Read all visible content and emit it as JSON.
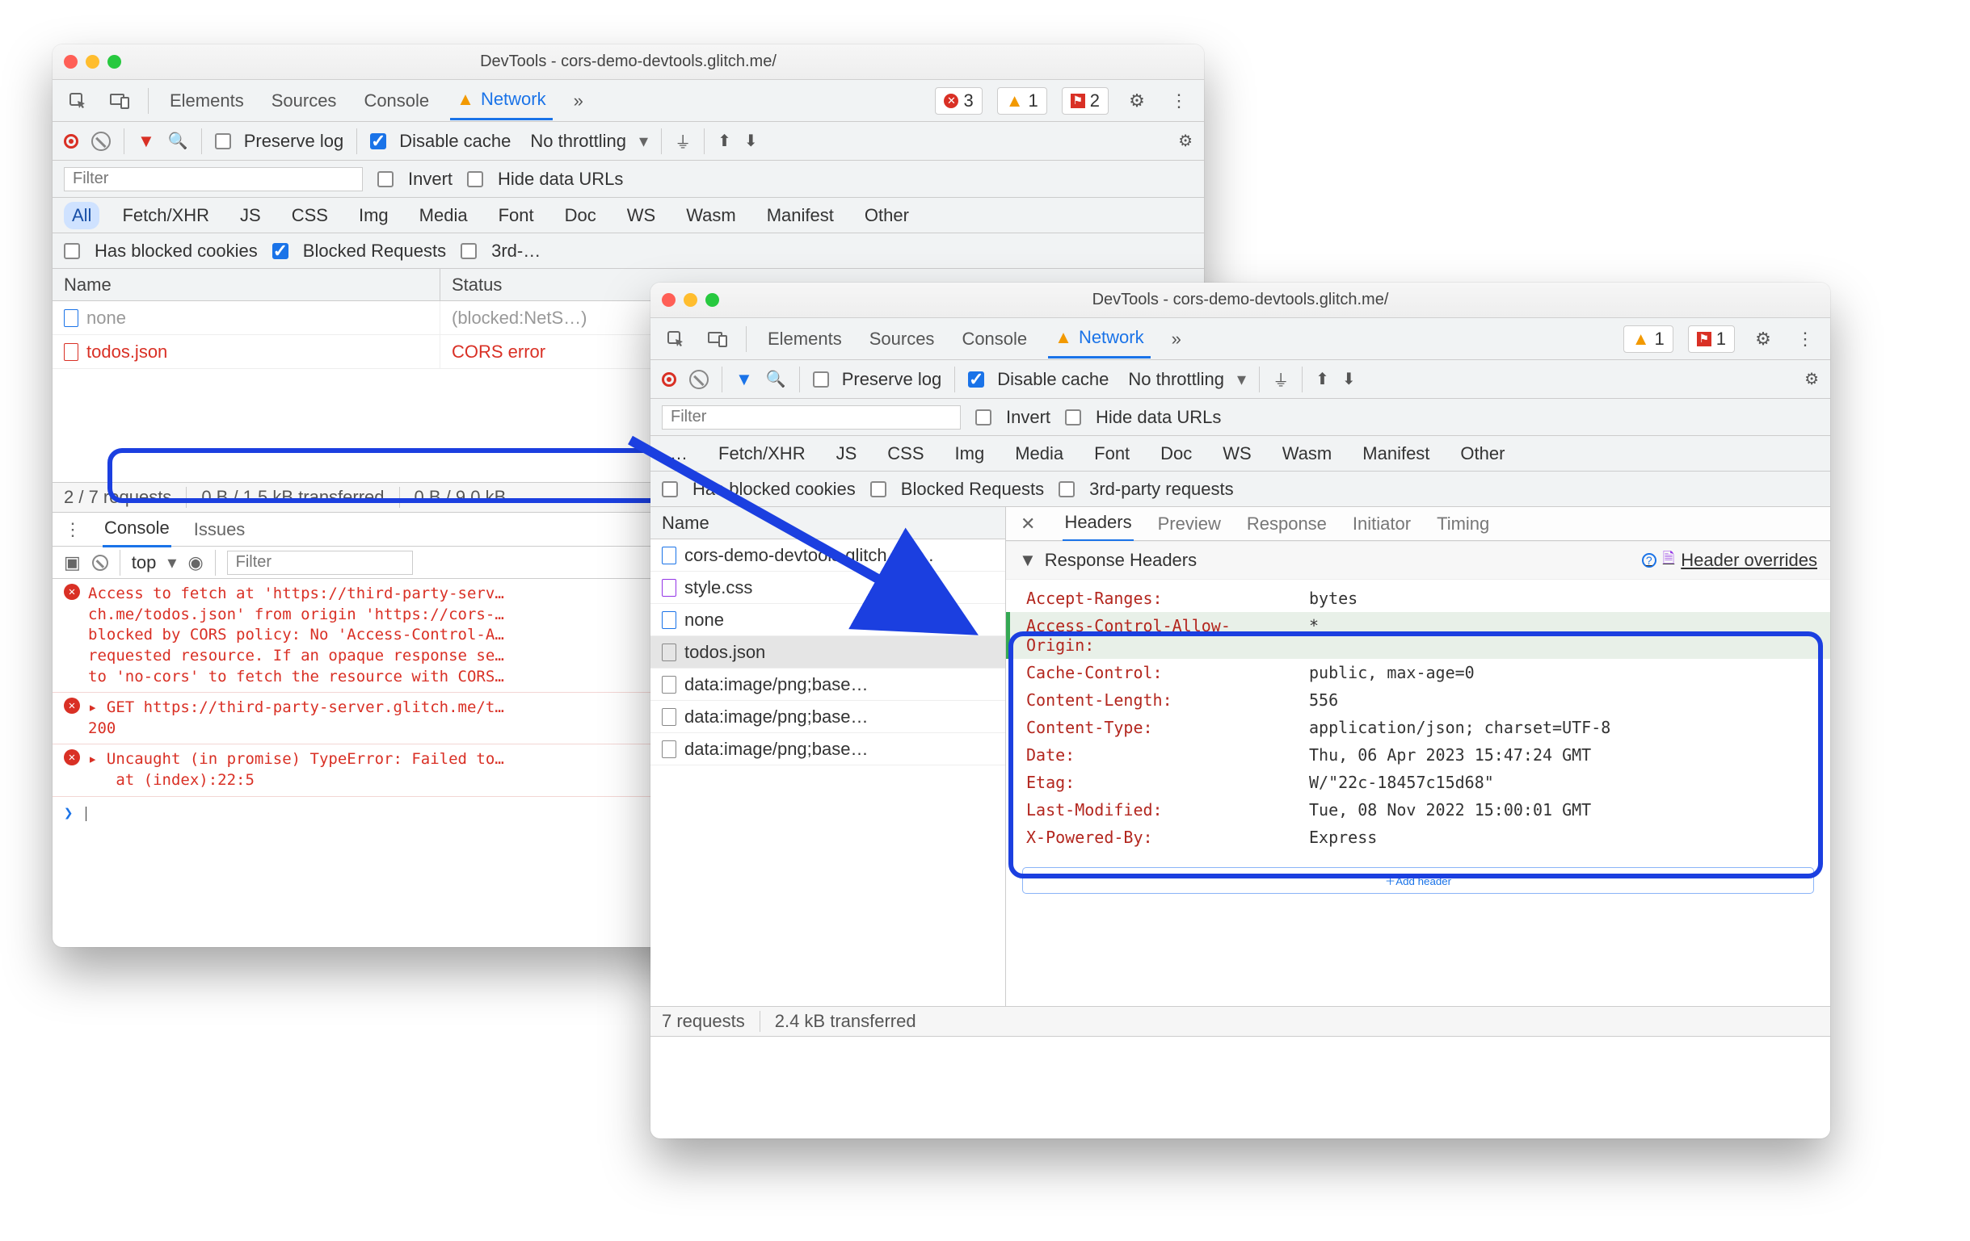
{
  "win1": {
    "title": "DevTools - cors-demo-devtools.glitch.me/",
    "tabs": [
      "Elements",
      "Sources",
      "Console",
      "Network"
    ],
    "active_tab": "Network",
    "badges": {
      "err": "3",
      "warn": "1",
      "issue": "2"
    },
    "netbar": {
      "preserve": "Preserve log",
      "disable_cache": "Disable cache",
      "throttling": "No throttling"
    },
    "filter_placeholder": "Filter",
    "invert": "Invert",
    "hide_data_urls": "Hide data URLs",
    "types": [
      "All",
      "Fetch/XHR",
      "JS",
      "CSS",
      "Img",
      "Media",
      "Font",
      "Doc",
      "WS",
      "Wasm",
      "Manifest",
      "Other"
    ],
    "blocked_cookies": "Has blocked cookies",
    "blocked_requests": "Blocked Requests",
    "third_party": "3rd-…",
    "columns": {
      "name": "Name",
      "status": "Status"
    },
    "rows": [
      {
        "name": "none",
        "status": "(blocked:NetS…)"
      },
      {
        "name": "todos.json",
        "status": "CORS error",
        "error": true
      }
    ],
    "footer": {
      "requests": "2 / 7 requests",
      "transferred": "0 B / 1.5 kB transferred",
      "resources": "0 B / 9.0 kB …"
    },
    "drawer_tabs": [
      "Console",
      "Issues"
    ],
    "console_context": "top",
    "console_filter": "Filter",
    "console_msgs": [
      "Access to fetch at 'https://third-party-serv…\nch.me/todos.json' from origin 'https://cors-…\nblocked by CORS policy: No 'Access-Control-A…\nrequested resource. If an opaque response se…\nto 'no-cors' to fetch the resource with CORS…",
      "▸ GET https://third-party-server.glitch.me/t…\n200",
      "▸ Uncaught (in promise) TypeError: Failed to…\n   at (index):22:5"
    ]
  },
  "win2": {
    "title": "DevTools - cors-demo-devtools.glitch.me/",
    "tabs": [
      "Elements",
      "Sources",
      "Console",
      "Network"
    ],
    "active_tab": "Network",
    "badges": {
      "warn": "1",
      "issue": "1"
    },
    "netbar": {
      "preserve": "Preserve log",
      "disable_cache": "Disable cache",
      "throttling": "No throttling"
    },
    "filter_placeholder": "Filter",
    "invert": "Invert",
    "hide_data_urls": "Hide data URLs",
    "types": [
      "…",
      "Fetch/XHR",
      "JS",
      "CSS",
      "Img",
      "Media",
      "Font",
      "Doc",
      "WS",
      "Wasm",
      "Manifest",
      "Other"
    ],
    "blocked_cookies": "Has blocked cookies",
    "blocked_requests": "Blocked Requests",
    "third_party": "3rd-party requests",
    "left_header": "Name",
    "requests": [
      {
        "name": "cors-demo-devtools.glitch.me…",
        "type": "doc"
      },
      {
        "name": "style.css",
        "type": "css"
      },
      {
        "name": "none",
        "type": "doc"
      },
      {
        "name": "todos.json",
        "type": "gray",
        "selected": true
      },
      {
        "name": "data:image/png;base…",
        "type": "gray"
      },
      {
        "name": "data:image/png;base…",
        "type": "gray"
      },
      {
        "name": "data:image/png;base…",
        "type": "gray"
      }
    ],
    "detail_tabs": [
      "Headers",
      "Preview",
      "Response",
      "Initiator",
      "Timing"
    ],
    "detail_active": "Headers",
    "response_headers_label": "Response Headers",
    "header_overrides_link": "Header overrides",
    "headers": [
      {
        "name": "Accept-Ranges:",
        "value": "bytes"
      },
      {
        "name": "Access-Control-Allow-Origin:",
        "value": "*",
        "edited": true
      },
      {
        "name": "Cache-Control:",
        "value": "public, max-age=0"
      },
      {
        "name": "Content-Length:",
        "value": "556"
      },
      {
        "name": "Content-Type:",
        "value": "application/json; charset=UTF-8"
      },
      {
        "name": "Date:",
        "value": "Thu, 06 Apr 2023 15:47:24 GMT"
      },
      {
        "name": "Etag:",
        "value": "W/\"22c-18457c15d68\""
      },
      {
        "name": "Last-Modified:",
        "value": "Tue, 08 Nov 2022 15:00:01 GMT"
      },
      {
        "name": "X-Powered-By:",
        "value": "Express"
      }
    ],
    "add_header": "Add header",
    "footer": {
      "requests": "7 requests",
      "transferred": "2.4 kB transferred"
    }
  }
}
